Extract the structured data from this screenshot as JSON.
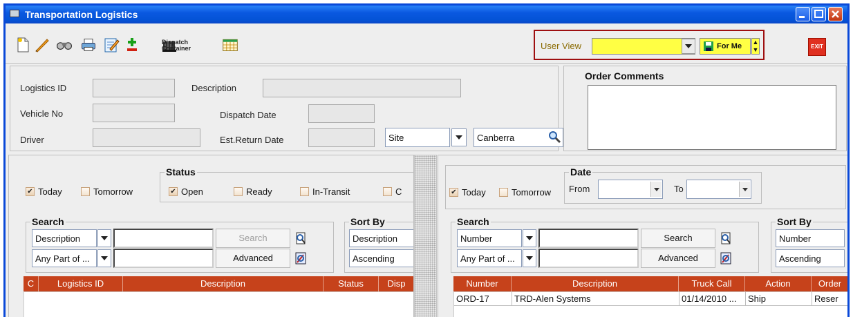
{
  "window": {
    "title": "Transportation Logistics"
  },
  "toolbar": {
    "icons": [
      "new-doc-icon",
      "edit-pencil-icon",
      "binoculars-icon",
      "print-icon",
      "notepad-edit-icon",
      "add-remove-icon",
      "dispatch-container-icon",
      "calendar-grid-icon"
    ],
    "dispatch_label_1": "Dispatch",
    "dispatch_label_2": "Container",
    "user_view_label": "User View",
    "user_view_value": "",
    "for_me_label": "For Me",
    "exit_label": "EXIT"
  },
  "header": {
    "logistics_id_label": "Logistics ID",
    "logistics_id_value": "",
    "description_label": "Description",
    "description_value": "",
    "vehicle_no_label": "Vehicle No",
    "vehicle_no_value": "",
    "dispatch_date_label": "Dispatch Date",
    "dispatch_date_value": "",
    "driver_label": "Driver",
    "driver_value": "",
    "est_return_label": "Est.Return Date",
    "est_return_value": "",
    "site_selector": "Site",
    "site_value": "Canberra",
    "order_comments_label": "Order Comments",
    "order_comments_value": ""
  },
  "left": {
    "today_label": "Today",
    "today_checked": true,
    "tomorrow_label": "Tomorrow",
    "tomorrow_checked": false,
    "status_title": "Status",
    "status_open": "Open",
    "status_ready": "Ready",
    "status_intransit": "In-Transit",
    "status_cut": "C",
    "search_title": "Search",
    "search_field": "Description",
    "search_mode": "Any Part of ...",
    "search_text_1": "",
    "search_text_2": "",
    "search_btn": "Search",
    "advanced_btn": "Advanced",
    "sort_title": "Sort By",
    "sort_field": "Description",
    "sort_order": "Ascending",
    "columns": [
      "C",
      "Logistics ID",
      "Description",
      "Status",
      "Disp"
    ]
  },
  "right": {
    "today_label": "Today",
    "today_checked": true,
    "tomorrow_label": "Tomorrow",
    "tomorrow_checked": false,
    "date_title": "Date",
    "from_label": "From",
    "to_label": "To",
    "from_value": "",
    "to_value": "",
    "search_title": "Search",
    "search_field": "Number",
    "search_mode": "Any Part of ...",
    "search_btn": "Search",
    "advanced_btn": "Advanced",
    "sort_title": "Sort By",
    "sort_field": "Number",
    "sort_order": "Ascending",
    "columns": [
      "Number",
      "Description",
      "Truck Call",
      "Action",
      "Order"
    ],
    "rows": [
      {
        "number": "ORD-17",
        "description": "TRD-Alen Systems",
        "truck_call": "01/14/2010 ...",
        "action": "Ship",
        "order": "Reser"
      }
    ]
  }
}
